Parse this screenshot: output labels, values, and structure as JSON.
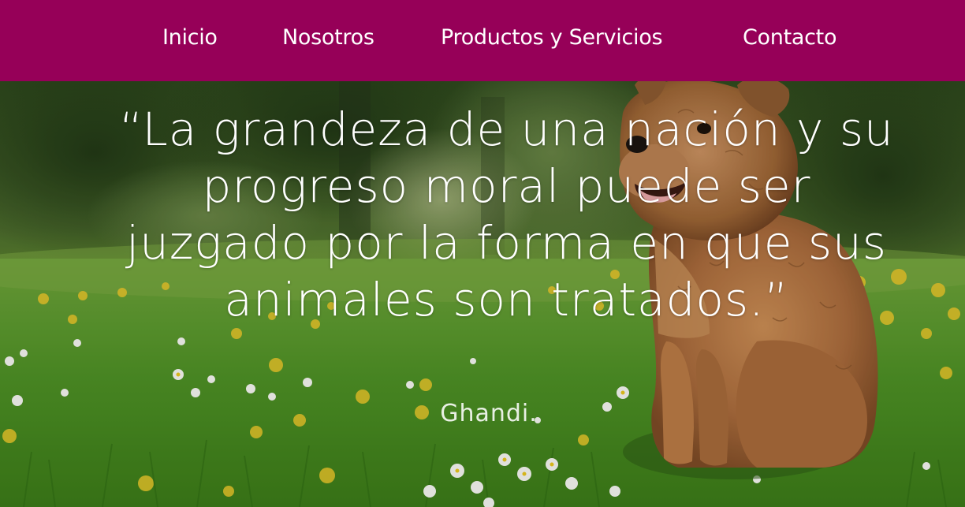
{
  "nav": {
    "items": [
      {
        "label": "Inicio"
      },
      {
        "label": "Nosotros"
      },
      {
        "label": "Productos y Servicios"
      },
      {
        "label": "Contacto"
      }
    ]
  },
  "hero": {
    "quote": "“La grandeza de una nación y su progreso moral puede ser juzgado por la forma en que sus animales son tratados.”",
    "author": "Ghandi."
  },
  "colors": {
    "nav_background": "#960058",
    "text": "#ffffff"
  }
}
